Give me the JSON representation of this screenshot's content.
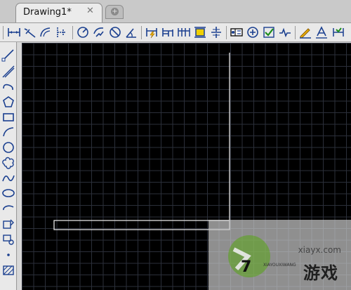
{
  "tabs": {
    "active": {
      "label": "Drawing1*",
      "close_glyph": "✕"
    },
    "new_tab_glyph": "+"
  },
  "toolbar": {
    "icons": [
      "linear-dimension-icon",
      "aligned-dimension-icon",
      "arc-length-dimension-icon",
      "ordinate-dimension-icon",
      "radius-dimension-icon",
      "jogged-dimension-icon",
      "diameter-dimension-icon",
      "angular-dimension-icon",
      "quick-dimension-icon",
      "baseline-dimension-icon",
      "continue-dimension-icon",
      "dimension-space-icon",
      "dimension-break-icon",
      "tolerance-icon",
      "center-mark-icon",
      "inspection-icon",
      "jogged-linear-icon",
      "dimension-edit-icon",
      "dimension-text-edit-icon",
      "dimension-update-icon"
    ]
  },
  "lefttoolbar": {
    "icons": [
      "line-icon",
      "construction-line-icon",
      "polyline-icon",
      "polygon-icon",
      "rectangle-icon",
      "arc-icon",
      "circle-icon",
      "revision-cloud-icon",
      "spline-icon",
      "ellipse-icon",
      "ellipse-arc-icon",
      "insert-block-icon",
      "make-block-icon",
      "point-icon",
      "hatch-icon"
    ]
  },
  "watermark": {
    "site": "xiayx.com",
    "name": "游戏",
    "small": "XIAYOUXIWANG",
    "logo_text": "7"
  }
}
